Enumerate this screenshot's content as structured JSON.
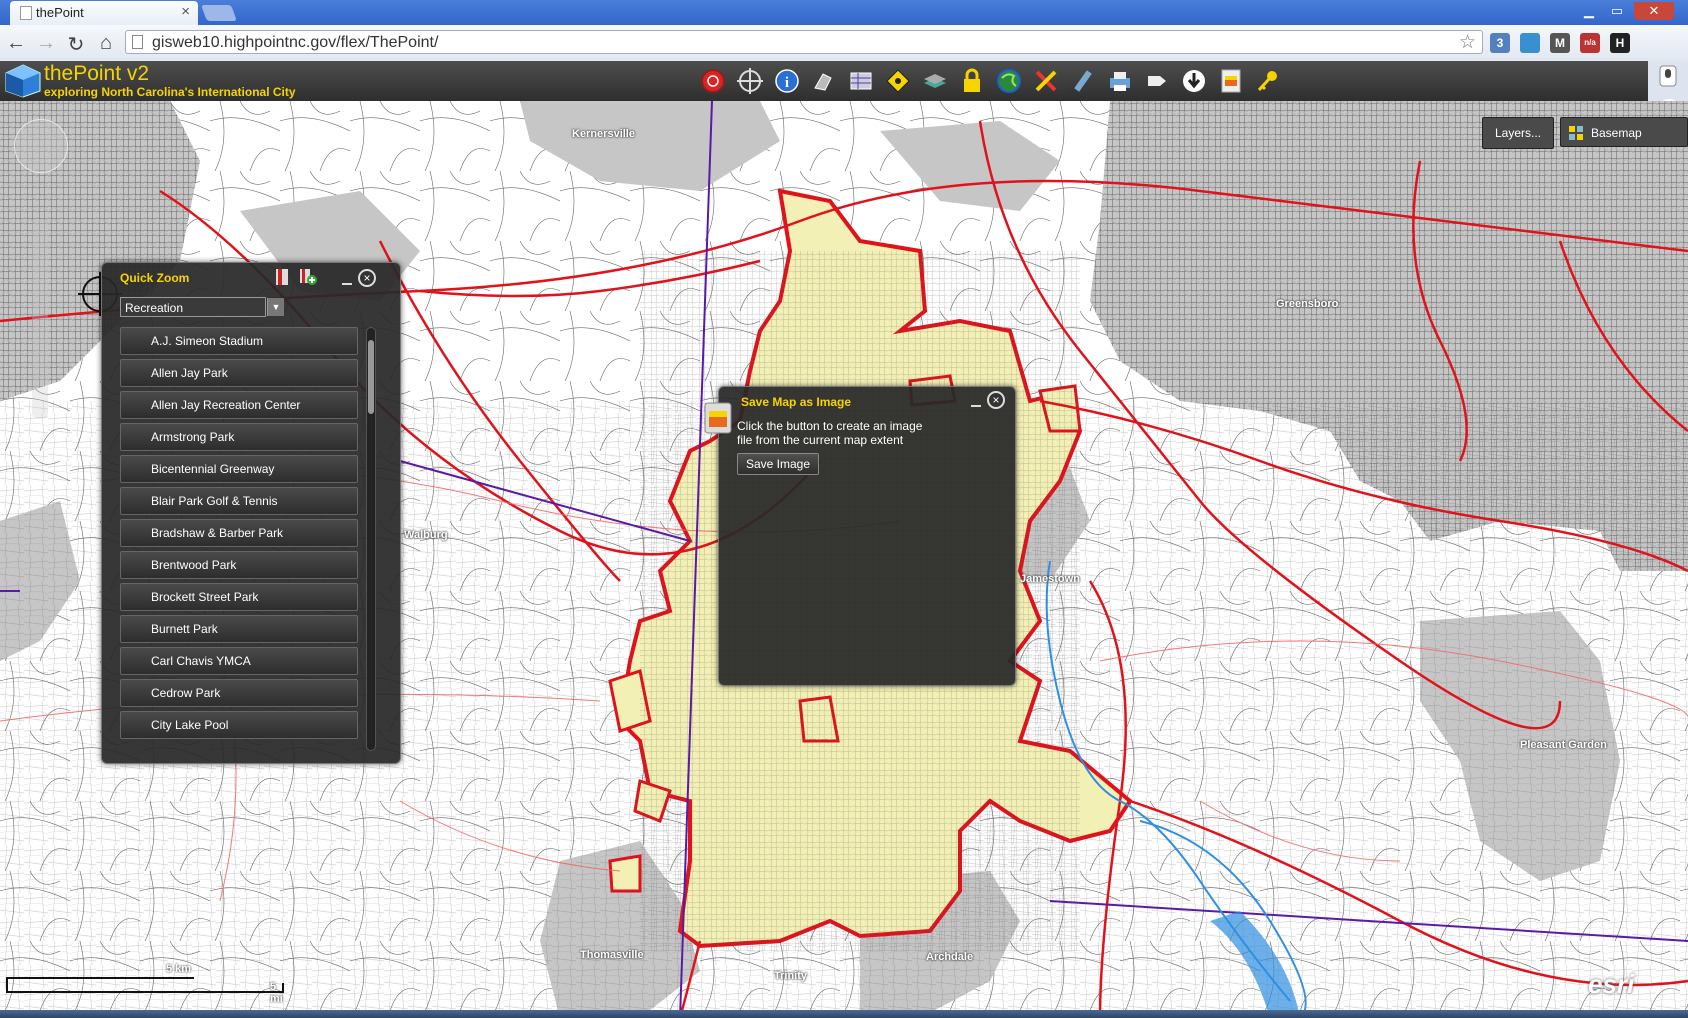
{
  "browser": {
    "tab_title": "thePoint",
    "url": "gisweb10.highpointnc.gov/flex/ThePoint/",
    "window_min": "▁",
    "window_max": "▭",
    "window_close": "✕",
    "tab_close": "×",
    "ext_badges": [
      "3",
      "",
      "M",
      "n/a",
      "H"
    ]
  },
  "app": {
    "title": "thePoint v2",
    "subtitle": "exploring North Carolina's International City",
    "toolbar_icons": [
      "record-icon",
      "crosshair-icon",
      "info-icon",
      "draw-icon",
      "table-icon",
      "zoom-to-icon",
      "layers-stack-icon",
      "lock-icon",
      "globe-icon",
      "clear-icon",
      "measure-icon",
      "print-icon",
      "pointer-icon",
      "download-icon",
      "save-image-icon",
      "key-icon"
    ]
  },
  "map": {
    "layers_button": "Layers...",
    "basemap_button": "Basemap",
    "labels": [
      "Kernersville",
      "Greensboro",
      "Walburg",
      "Jamestown",
      "Pleasant Garden",
      "Thomasville",
      "Archdale",
      "Trinity"
    ],
    "scale_km": "5 km",
    "scale_mi": "5 mi",
    "esri": "esri"
  },
  "quick_zoom": {
    "title": "Quick Zoom",
    "category": "Recreation",
    "items": [
      "A.J. Simeon Stadium",
      "Allen Jay Park",
      "Allen Jay Recreation Center",
      "Armstrong Park",
      "Bicentennial Greenway",
      "Blair Park Golf & Tennis",
      "Bradshaw & Barber Park",
      "Brentwood Park",
      "Brockett Street Park",
      "Burnett Park",
      "Carl Chavis YMCA",
      "Cedrow Park",
      "City Lake Pool"
    ]
  },
  "save_map": {
    "title": "Save Map as Image",
    "description": "Click the button to create an image file from the current map extent",
    "button": "Save Image"
  },
  "colors": {
    "accent": "#f6d400",
    "city_fill": "#f2f0b4",
    "city_border": "#e0121b",
    "urban_gray": "#c8c8c8"
  }
}
